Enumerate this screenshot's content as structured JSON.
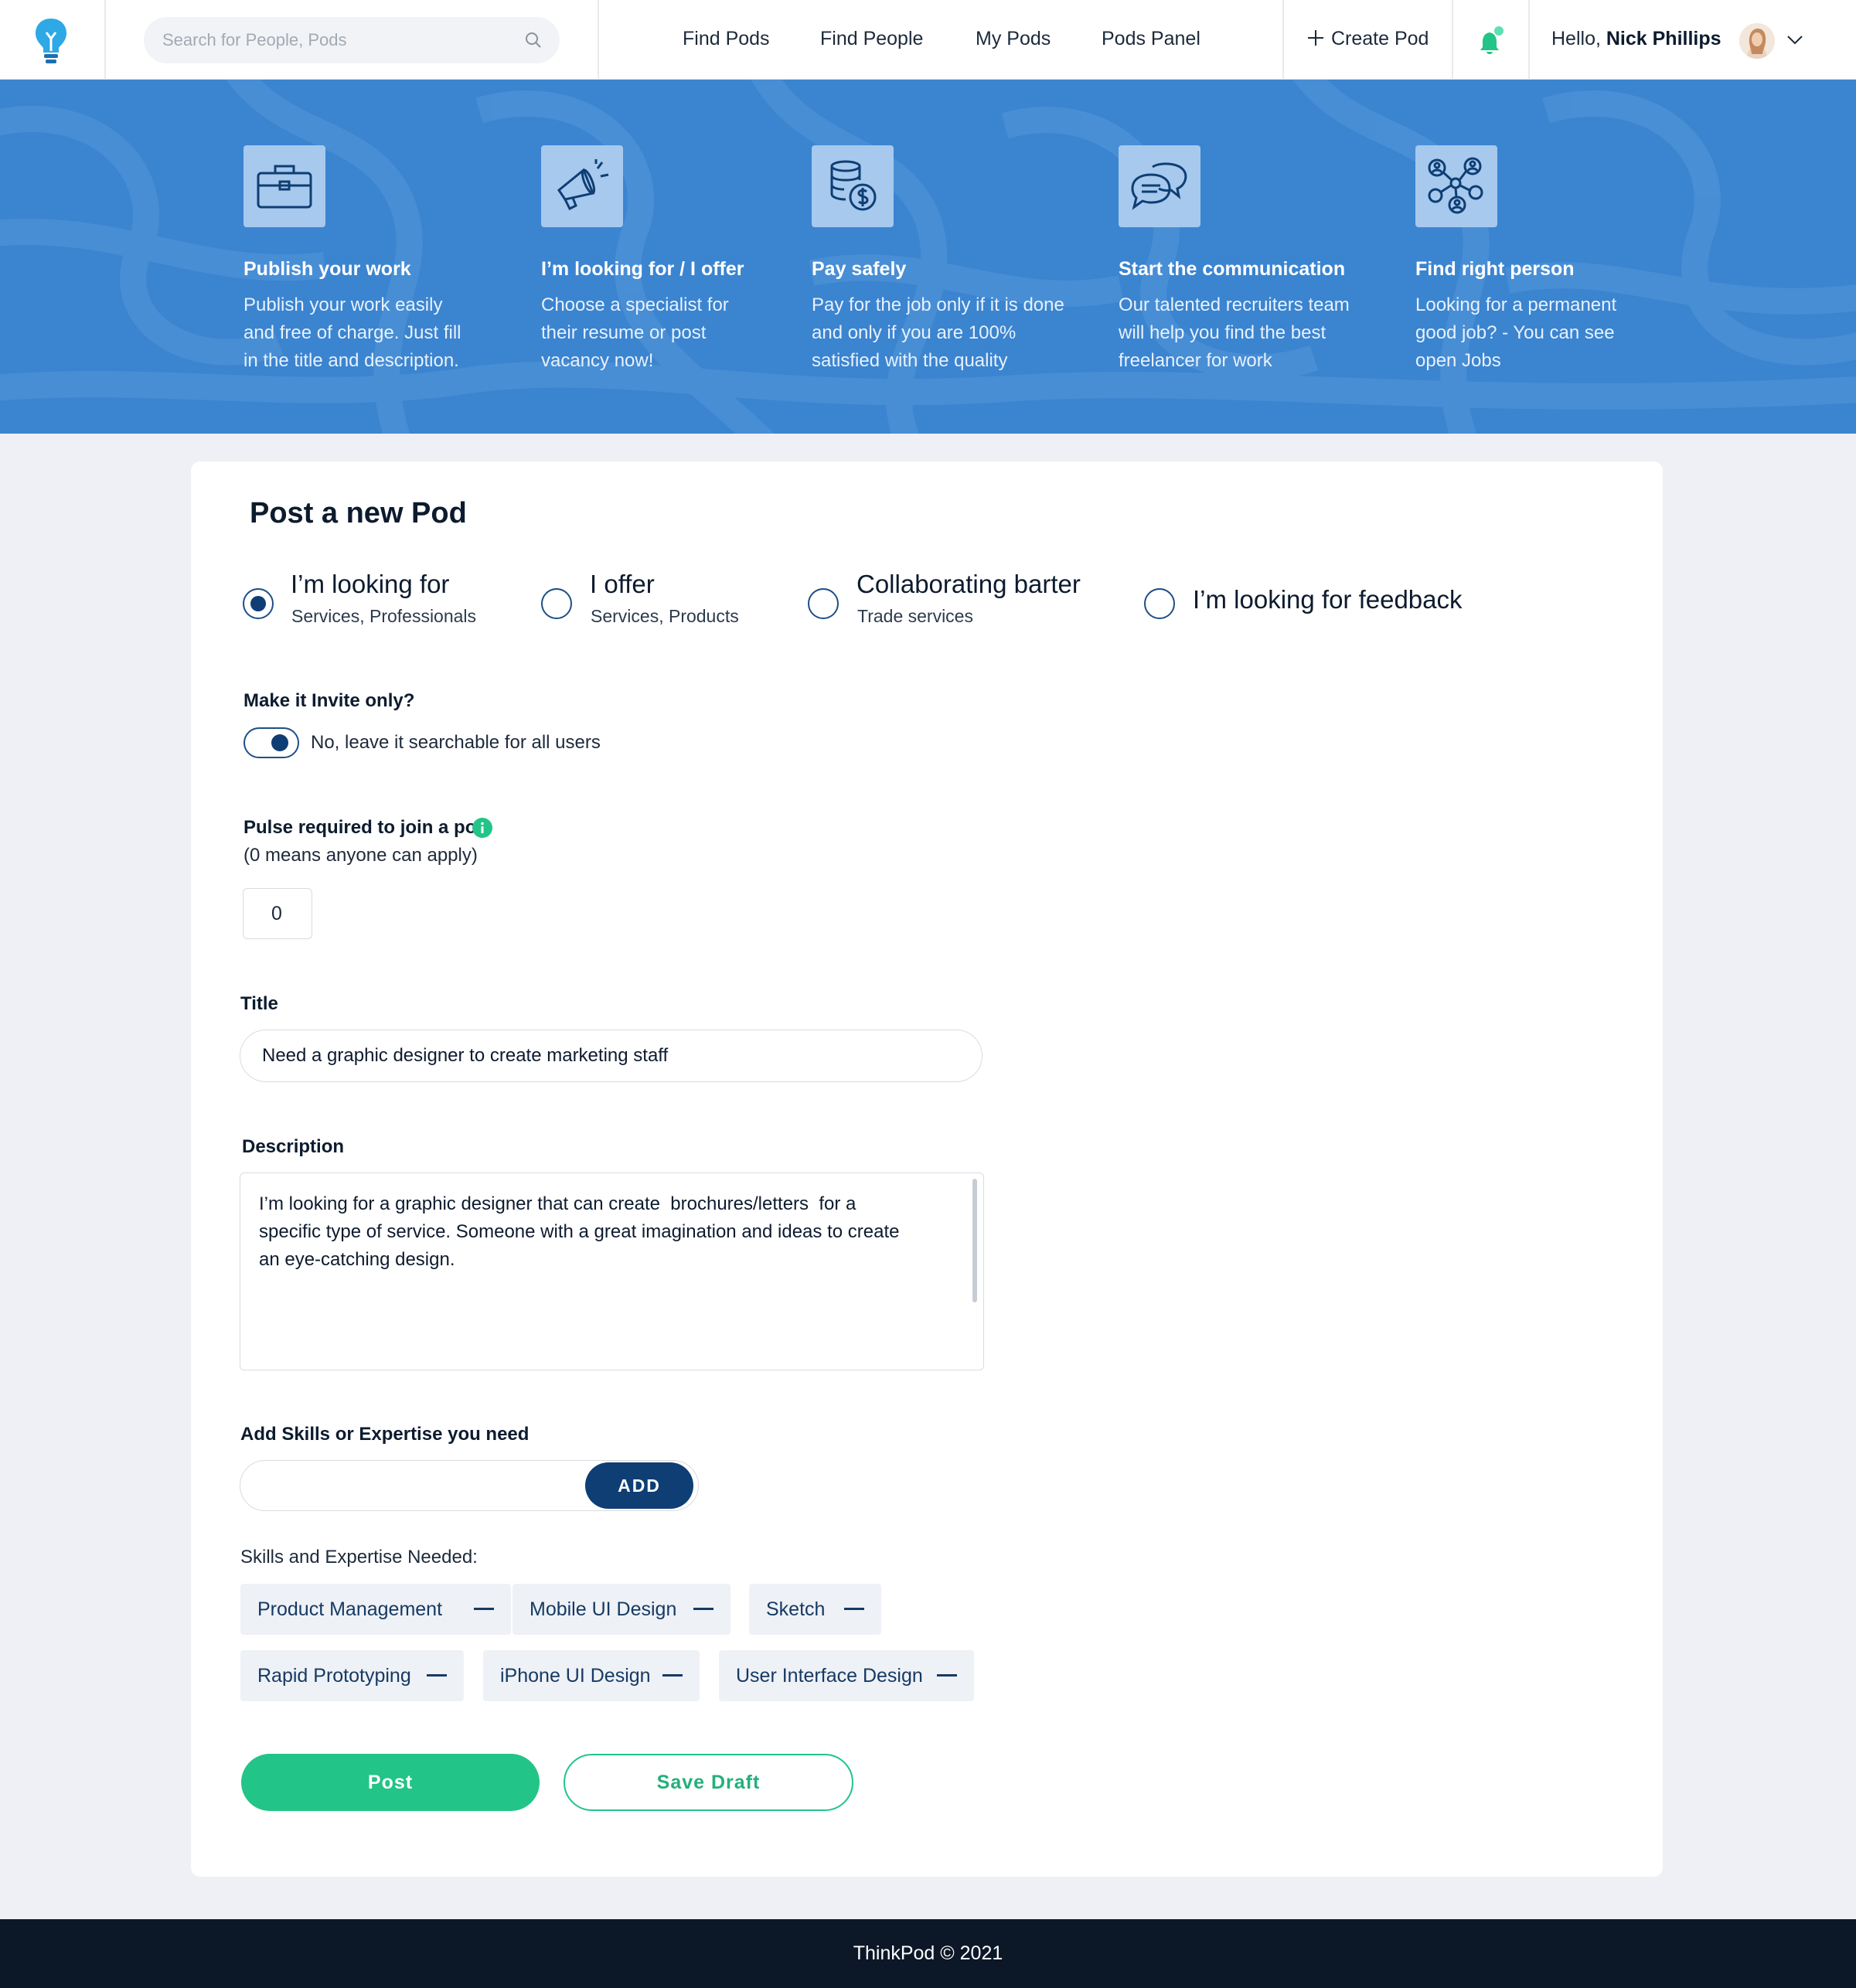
{
  "header": {
    "search_placeholder": "Search for People, Pods",
    "nav": [
      "Find Pods",
      "Find People",
      "My Pods",
      "Pods Panel"
    ],
    "create_pod": "Create Pod",
    "greeting_prefix": "Hello,",
    "user_name": "Nick Phillips"
  },
  "features": [
    {
      "icon": "briefcase-icon",
      "title": "Publish your work",
      "desc": "Publish your work easily and free of charge. Just fill in the title and description."
    },
    {
      "icon": "megaphone-icon",
      "title": "I’m looking for / I offer",
      "desc": "Choose a specialist for their resume or post vacancy now!"
    },
    {
      "icon": "coins-icon",
      "title": "Pay safely",
      "desc": "Pay for the job only if it is done and only if you are 100% satisfied with the quality"
    },
    {
      "icon": "chat-bubbles-icon",
      "title": "Start the communication",
      "desc": "Our talented recruiters team will help you find the best freelancer for work"
    },
    {
      "icon": "network-people-icon",
      "title": "Find right person",
      "desc": "Looking for a permanent good job? - You can see open Jobs"
    }
  ],
  "form": {
    "title": "Post a new Pod",
    "options": [
      {
        "label": "I’m looking for",
        "sub": "Services, Professionals",
        "selected": true
      },
      {
        "label": "I offer",
        "sub": "Services, Products",
        "selected": false
      },
      {
        "label": "Collaborating barter",
        "sub": "Trade services",
        "selected": false
      },
      {
        "label": "I’m looking for feedback",
        "sub": "",
        "selected": false
      }
    ],
    "invite_label": "Make it Invite only?",
    "invite_toggle_text": "No, leave it searchable for all users",
    "pulse_label": "Pulse required to join a pod",
    "pulse_note": "(0 means anyone can apply)",
    "pulse_value": "0",
    "title_label": "Title",
    "title_value": "Need a graphic designer to create marketing staff",
    "description_label": "Description",
    "description_value": "I’m looking for a graphic designer that can create  brochures/letters  for a specific type of service. Someone with a great imagination and ideas to create an eye-catching design.",
    "skills_label": "Add Skills or Expertise you need",
    "add_button": "ADD",
    "skills_needed_label": "Skills and Expertise Needed:",
    "skills": [
      "Product Management",
      "Mobile UI Design",
      "Sketch",
      "Rapid Prototyping",
      "iPhone UI Design",
      "User Interface Design"
    ],
    "post_button": "Post",
    "draft_button": "Save Draft"
  },
  "footer": {
    "text": "ThinkPod © 2021"
  },
  "colors": {
    "primary_blue": "#3b84d0",
    "navy": "#0e3e73",
    "green": "#22c487",
    "footer": "#0c1728"
  }
}
